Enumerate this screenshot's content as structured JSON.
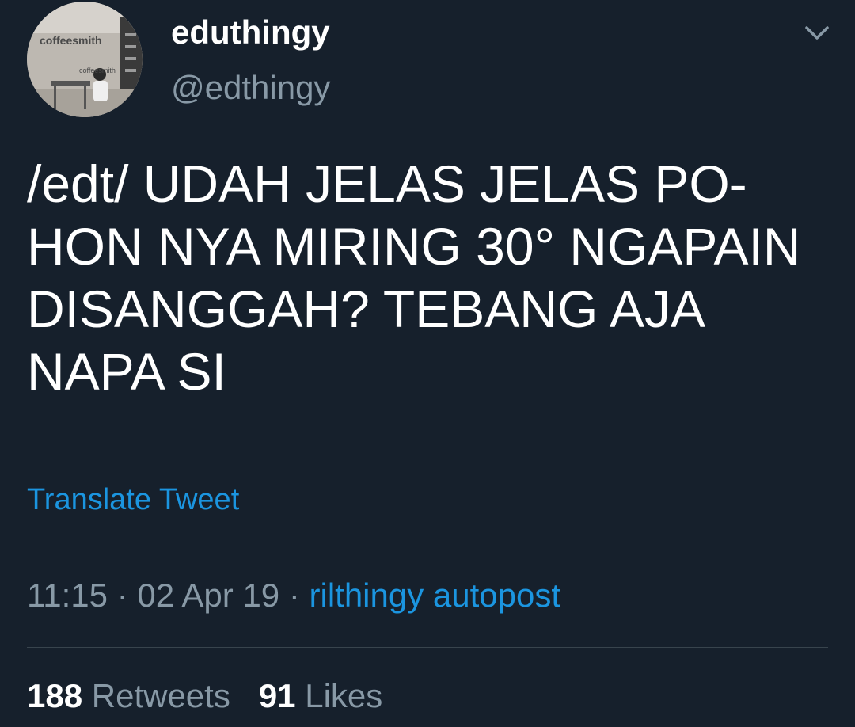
{
  "author": {
    "display_name": "eduthingy",
    "handle": "@edthingy",
    "avatar_sign_top": "coffeesmith",
    "avatar_sign_small": "coffeesmith"
  },
  "tweet": {
    "lines": [
      "/edt/ UDAH JELAS JELAS PO-",
      "HON NYA MIRING 30° NGAPAIN",
      "DISANGGAH? TEBANG AJA",
      "NAPA SI"
    ],
    "translate_label": "Translate Tweet",
    "time": "11:15",
    "separator": "·",
    "date": "02 Apr 19",
    "source": "rilthingy autopost"
  },
  "stats": {
    "retweets_count": "188",
    "retweets_label": "Retweets",
    "likes_count": "91",
    "likes_label": "Likes"
  },
  "icons": {
    "menu": "chevron-down-icon"
  },
  "colors": {
    "background": "#16202c",
    "text": "#ffffff",
    "muted": "#8899a6",
    "link": "#1b95e0",
    "divider": "#38444d"
  }
}
